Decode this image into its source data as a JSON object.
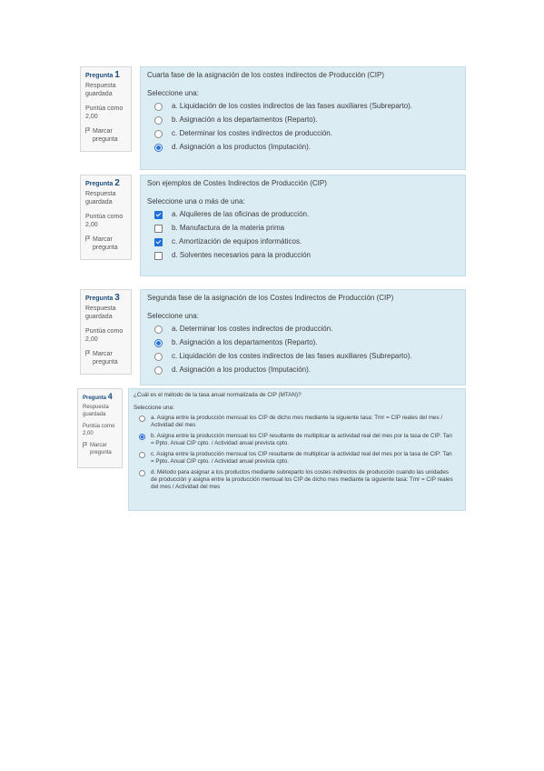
{
  "questions": [
    {
      "number_prefix": "Pregunta",
      "number": "1",
      "state": "Respuesta guardada",
      "grade": "Puntúa como 2,00",
      "flag_label": "Marcar pregunta",
      "text": "Cuarta fase de la asignación de los costes indirectos de Producción (CIP)",
      "prompt": "Seleccione una:",
      "type": "radio",
      "options": [
        {
          "label": "a. Liquidación de los costes indirectos de las fases auxiliares (Subreparto).",
          "selected": false
        },
        {
          "label": "b. Asignación a los departamentos (Reparto).",
          "selected": false
        },
        {
          "label": "c. Determinar los costes indirectos de producción.",
          "selected": false
        },
        {
          "label": "d. Asignación a los productos (Imputación).",
          "selected": true
        }
      ]
    },
    {
      "number_prefix": "Pregunta",
      "number": "2",
      "state": "Respuesta guardada",
      "grade": "Puntúa como 2,00",
      "flag_label": "Marcar pregunta",
      "text": "Son ejemplos de Costes Indirectos de Producción (CIP)",
      "prompt": "Seleccione una o más de una:",
      "type": "checkbox",
      "options": [
        {
          "label": "a. Alquileres de las oficinas de producción.",
          "selected": true
        },
        {
          "label": "b. Manufactura de la materia prima",
          "selected": false
        },
        {
          "label": "c. Amortización de equipos informáticos.",
          "selected": true
        },
        {
          "label": "d. Solventes necesarios para la producción",
          "selected": false
        }
      ]
    },
    {
      "number_prefix": "Pregunta",
      "number": "3",
      "state": "Respuesta guardada",
      "grade": "Puntúa como 2,00",
      "flag_label": "Marcar pregunta",
      "text": "Segunda fase de la asignación de los Costes Indirectos de Producción (CIP)",
      "prompt": "Seleccione una:",
      "type": "radio",
      "options": [
        {
          "label": "a. Determinar los costes indirectos de producción.",
          "selected": false
        },
        {
          "label": "b. Asignación a los departamentos (Reparto).",
          "selected": true
        },
        {
          "label": "c. Liquidación de los costes indirectos de las fases auxiliares (Subreparto).",
          "selected": false
        },
        {
          "label": "d. Asignación a los productos (Imputación).",
          "selected": false
        }
      ]
    },
    {
      "number_prefix": "Pregunta",
      "number": "4",
      "state": "Respuesta guardada",
      "grade": "Puntúa como 2,00",
      "flag_label": "Marcar pregunta",
      "text": "¿Cuál es el método de la tasa anual normalizada de CIP (MTAN)?",
      "prompt": "Seleccione una:",
      "type": "radio",
      "options": [
        {
          "label": "a. Asigna entre la producción mensual los CIP de dicho mes mediante la siguiente tasa: Tmr = CIP reales del mes / Actividad del mes",
          "selected": false
        },
        {
          "label": "b. Asigna entre la producción mensual los CIP resultante de multiplicar la actividad real del mes por la tasa de CIP: Tan = Ppto. Anual CIP cpto. / Actividad anual prevista cpto.",
          "selected": true
        },
        {
          "label": "c. Asigna entre la producción mensual los CIP resultante de multiplicar la actividad real del mes por la tasa de CIP: Tan = Ppto. Anual CIP cpto. / Actividad anual prevista cpto.",
          "selected": false
        },
        {
          "label": "d. Método para asignar a los productos mediante subreparto los costes indirectos de producción cuando las unidades de producción y asigna entre la producción mensual los CIP de dicho mes mediante la siguiente tasa: Tmr = CIP reales del mes / Actividad del mes",
          "selected": false
        }
      ]
    }
  ]
}
